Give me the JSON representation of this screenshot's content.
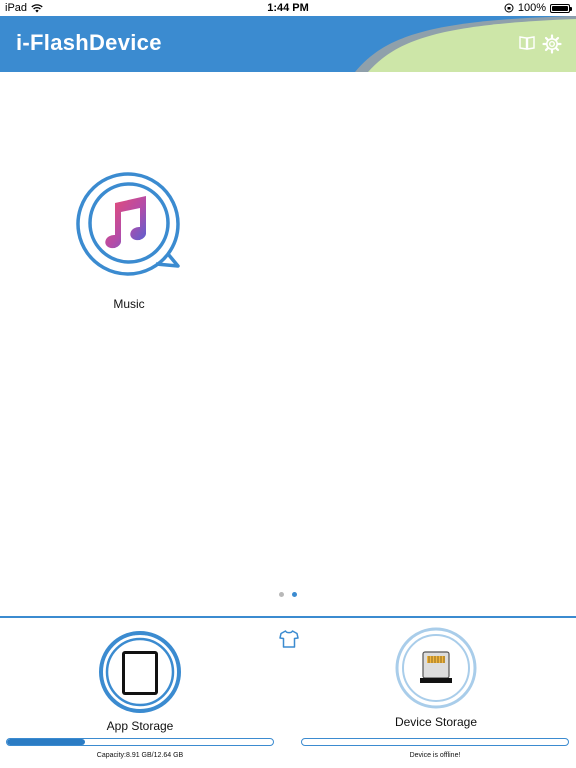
{
  "status_bar": {
    "device": "iPad",
    "time": "1:44 PM",
    "battery_text": "100%",
    "battery_level": 1.0
  },
  "header": {
    "title": "i-FlashDevice",
    "accent_color": "#3b8bd0",
    "deco_color": "#cde6a8",
    "book_icon": "book-icon",
    "settings_icon": "gear-icon"
  },
  "apps": [
    {
      "label": "Music",
      "icon": "music-note-icon"
    }
  ],
  "pager": {
    "page_count": 2,
    "active_index": 1
  },
  "bottom": {
    "theme_icon": "tshirt-icon",
    "app_storage": {
      "label": "App Storage",
      "capacity_text": "Capacity:8.91 GB/12.64 GB",
      "used_fraction": 0.295
    },
    "device_storage": {
      "label": "Device Storage",
      "status_text": "Device is offline!",
      "used_fraction": 0
    }
  }
}
